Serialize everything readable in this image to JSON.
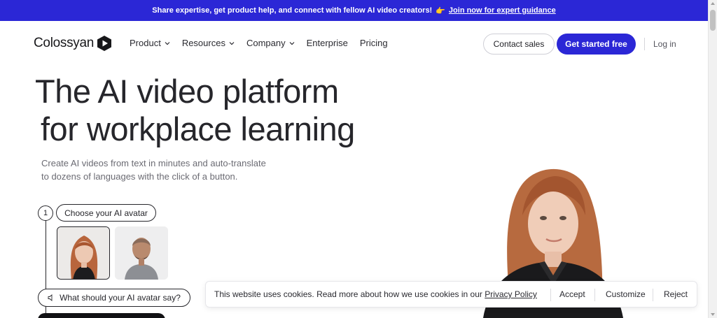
{
  "announcement": {
    "text": "Share expertise, get product help, and connect with fellow AI video creators!",
    "emoji": "👉",
    "link": "Join now for expert guidance"
  },
  "header": {
    "brand": "Colossyan",
    "menu": {
      "product": "Product",
      "resources": "Resources",
      "company": "Company",
      "enterprise": "Enterprise",
      "pricing": "Pricing"
    },
    "contact_sales": "Contact sales",
    "get_started": "Get started free",
    "login": "Log in"
  },
  "hero": {
    "title_line1": "The AI video platform",
    "title_line2": "for workplace learning",
    "subtitle_line1": "Create AI videos from text in minutes and auto-translate",
    "subtitle_line2": "to dozens of languages with the click of a button."
  },
  "steps": {
    "step_number": "1",
    "choose_label": "Choose your AI avatar",
    "say_label": "What should your AI avatar say?"
  },
  "cookie": {
    "text": "This website uses cookies. Read more about how we use cookies in our",
    "policy_link": "Privacy Policy",
    "accept": "Accept",
    "customize": "Customize",
    "reject": "Reject"
  },
  "colors": {
    "brand_blue": "#2b27d6",
    "text_dark": "#26262b"
  }
}
